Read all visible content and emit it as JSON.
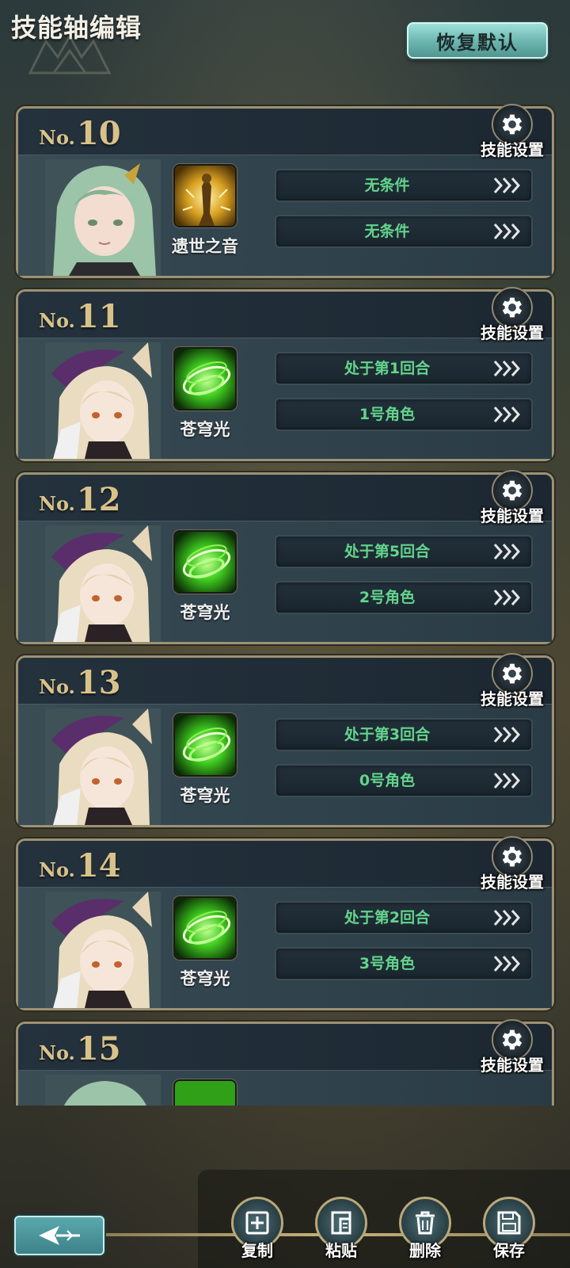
{
  "header": {
    "title": "技能轴编辑",
    "reset_label": "恢复默认"
  },
  "cards": [
    {
      "no_prefix": "No.",
      "number": "10",
      "settings_label": "技能设置",
      "character": "green-haired-heroine",
      "skill": {
        "name": "遗世之音",
        "icon": "golden-figure-skill-icon"
      },
      "conditions": [
        "无条件",
        "无条件"
      ]
    },
    {
      "no_prefix": "No.",
      "number": "11",
      "settings_label": "技能设置",
      "character": "blonde-rabbit-eared-girl",
      "skill": {
        "name": "苍穹光",
        "icon": "green-whirlwind-skill-icon"
      },
      "conditions": [
        "处于第1回合",
        "1号角色"
      ]
    },
    {
      "no_prefix": "No.",
      "number": "12",
      "settings_label": "技能设置",
      "character": "blonde-rabbit-eared-girl",
      "skill": {
        "name": "苍穹光",
        "icon": "green-whirlwind-skill-icon"
      },
      "conditions": [
        "处于第5回合",
        "2号角色"
      ]
    },
    {
      "no_prefix": "No.",
      "number": "13",
      "settings_label": "技能设置",
      "character": "blonde-rabbit-eared-girl",
      "skill": {
        "name": "苍穹光",
        "icon": "green-whirlwind-skill-icon"
      },
      "conditions": [
        "处于第3回合",
        "0号角色"
      ]
    },
    {
      "no_prefix": "No.",
      "number": "14",
      "settings_label": "技能设置",
      "character": "blonde-rabbit-eared-girl",
      "skill": {
        "name": "苍穹光",
        "icon": "green-whirlwind-skill-icon"
      },
      "conditions": [
        "处于第2回合",
        "3号角色"
      ]
    },
    {
      "no_prefix": "No.",
      "number": "15",
      "settings_label": "技能设置",
      "character": "green-haired-heroine",
      "skill": {
        "name": "",
        "icon": "green-whirlwind-skill-icon"
      },
      "conditions": []
    }
  ],
  "toolbar": {
    "copy_label": "复制",
    "paste_label": "粘贴",
    "delete_label": "删除",
    "save_label": "保存"
  },
  "colors": {
    "card_border": "#9c9274",
    "number_gold": "#d9c28a",
    "condition_green": "#63d48c",
    "reset_teal": "#6fb8b2"
  }
}
